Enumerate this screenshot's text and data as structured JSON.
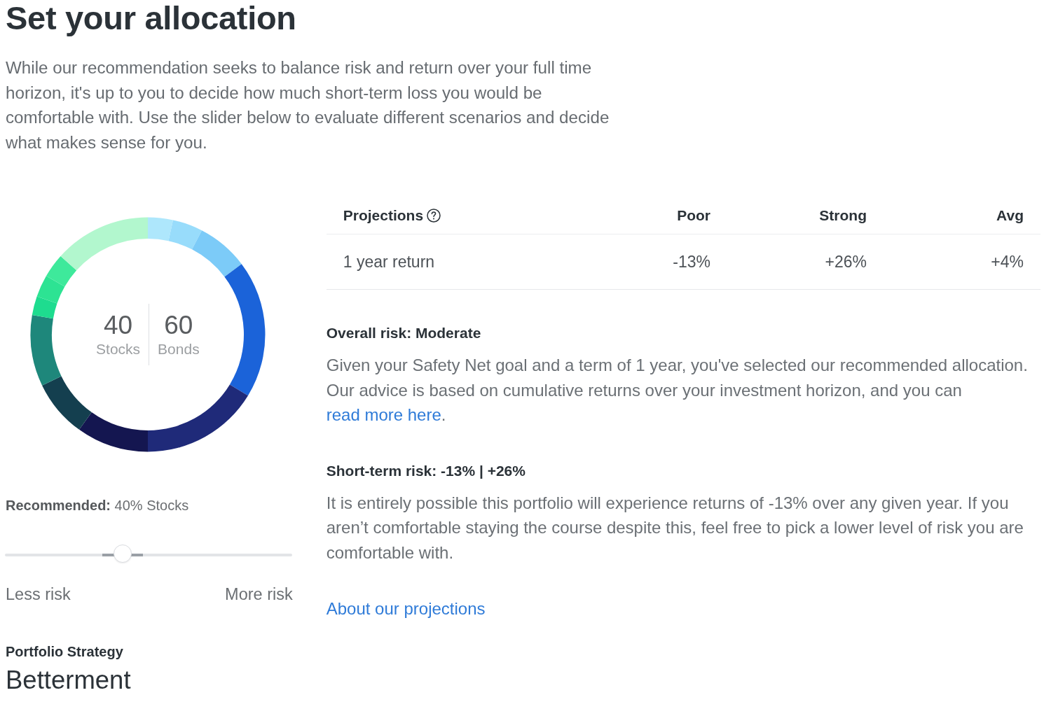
{
  "page": {
    "title": "Set your allocation",
    "intro": "While our recommendation seeks to balance risk and return over your full time horizon, it's up to you to decide how much short-term loss you would be comfortable with. Use the slider below to evaluate different scenarios and decide what makes sense for you."
  },
  "allocation": {
    "split": [
      {
        "value": "40",
        "label": "Stocks"
      },
      {
        "value": "60",
        "label": "Bonds"
      }
    ],
    "recommended": "**Recommended:** 40% Stocks",
    "slider": {
      "level": 0.41,
      "min_label": "Less risk",
      "max_label": "More risk"
    },
    "strategy": {
      "label": "Portfolio Strategy",
      "value": "Betterment"
    }
  },
  "projections": {
    "columns": [
      "Projections",
      "Poor",
      "Strong",
      "Avg"
    ],
    "rows": [
      {
        "label": "1 year return",
        "values": [
          "-13%",
          "+26%",
          "+4%"
        ]
      }
    ]
  },
  "risk_sections": [
    {
      "heading": "Overall risk: Moderate",
      "text": "Given your Safety Net goal and a term of 1 year, you've selected our recommended allocation. Our advice is based on cumulative returns over your investment horizon, and you can",
      "link": "read more here",
      "text_after": "."
    },
    {
      "heading": "Short-term risk: -13% | +26%",
      "text": "It is entirely possible this portfolio will experience returns of -13% over any given year. If you aren’t comfortable staying the course despite this, feel free to pick a lower level of risk you are comfortable with."
    }
  ],
  "about_link": "About our projections"
}
